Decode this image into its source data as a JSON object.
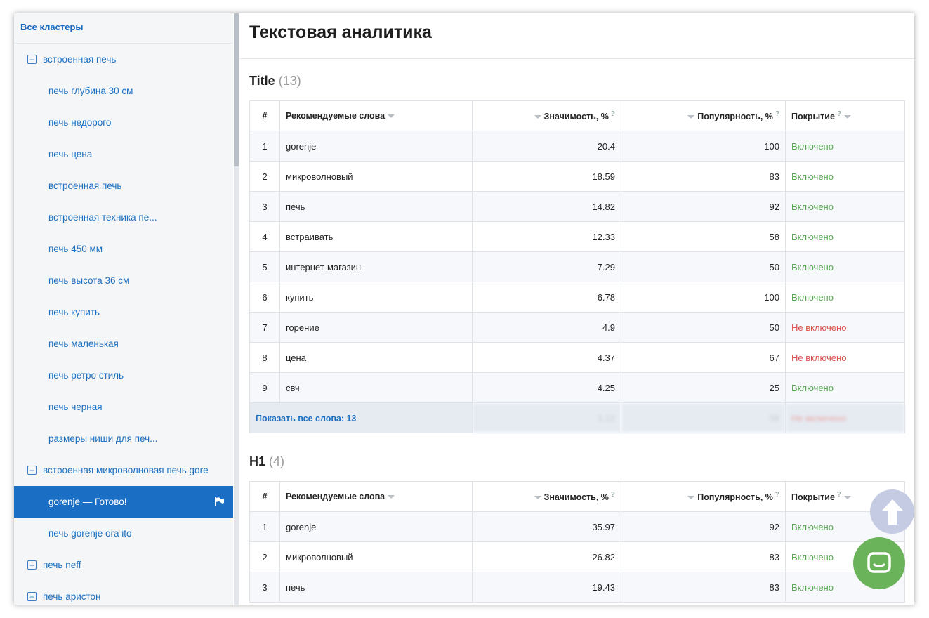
{
  "sidebar": {
    "all_clusters": "Все кластеры",
    "items": [
      {
        "label": "встроенная печь",
        "type": "group",
        "toggle": "−"
      },
      {
        "label": "печь глубина 30 см",
        "type": "item"
      },
      {
        "label": "печь недорого",
        "type": "item"
      },
      {
        "label": "печь цена",
        "type": "item"
      },
      {
        "label": "встроенная печь",
        "type": "item"
      },
      {
        "label": "встроенная техника пе...",
        "type": "item"
      },
      {
        "label": "печь 450 мм",
        "type": "item"
      },
      {
        "label": "печь высота 36 см",
        "type": "item"
      },
      {
        "label": "печь купить",
        "type": "item"
      },
      {
        "label": "печь маленькая",
        "type": "item"
      },
      {
        "label": "печь ретро стиль",
        "type": "item"
      },
      {
        "label": "печь черная",
        "type": "item"
      },
      {
        "label": "размеры ниши для печ...",
        "type": "item"
      },
      {
        "label": "встроенная микроволновая печь gore",
        "type": "group",
        "toggle": "−"
      },
      {
        "label": "gorenje — Готово!",
        "type": "item",
        "active": true
      },
      {
        "label": "печь gorenje ora ito",
        "type": "item"
      },
      {
        "label": "печь neff",
        "type": "group",
        "toggle": "+"
      },
      {
        "label": "печь аристон",
        "type": "group",
        "toggle": "+"
      }
    ]
  },
  "page_title": "Текстовая аналитика",
  "columns": {
    "num": "#",
    "words": "Рекомендуемые слова",
    "significance": "Значимость, %",
    "popularity": "Популярность, %",
    "coverage": "Покрытие",
    "help": "?"
  },
  "title_section": {
    "name": "Title",
    "count": "(13)",
    "rows": [
      {
        "n": "1",
        "word": "gorenje",
        "sig": "20.4",
        "pop": "100",
        "cov": "Включено",
        "status": "on"
      },
      {
        "n": "2",
        "word": "микроволновый",
        "sig": "18.59",
        "pop": "83",
        "cov": "Включено",
        "status": "on"
      },
      {
        "n": "3",
        "word": "печь",
        "sig": "14.82",
        "pop": "92",
        "cov": "Включено",
        "status": "on"
      },
      {
        "n": "4",
        "word": "встраивать",
        "sig": "12.33",
        "pop": "58",
        "cov": "Включено",
        "status": "on"
      },
      {
        "n": "5",
        "word": "интернет-магазин",
        "sig": "7.29",
        "pop": "50",
        "cov": "Включено",
        "status": "on"
      },
      {
        "n": "6",
        "word": "купить",
        "sig": "6.78",
        "pop": "100",
        "cov": "Включено",
        "status": "on"
      },
      {
        "n": "7",
        "word": "горение",
        "sig": "4.9",
        "pop": "50",
        "cov": "Не включено",
        "status": "off"
      },
      {
        "n": "8",
        "word": "цена",
        "sig": "4.37",
        "pop": "67",
        "cov": "Не включено",
        "status": "off"
      },
      {
        "n": "9",
        "word": "свч",
        "sig": "4.25",
        "pop": "25",
        "cov": "Включено",
        "status": "on"
      }
    ],
    "show_all": "Показать все слова: 13",
    "blur_row": {
      "sig": "3.12",
      "pop": "58",
      "cov": "Не включено"
    }
  },
  "h1_section": {
    "name": "H1",
    "count": "(4)",
    "rows": [
      {
        "n": "1",
        "word": "gorenje",
        "sig": "35.97",
        "pop": "92",
        "cov": "Включено",
        "status": "on"
      },
      {
        "n": "2",
        "word": "микроволновый",
        "sig": "26.82",
        "pop": "83",
        "cov": "Включено",
        "status": "on"
      },
      {
        "n": "3",
        "word": "печь",
        "sig": "19.43",
        "pop": "83",
        "cov": "Включено",
        "status": "on"
      }
    ]
  },
  "colors": {
    "accent": "#1a6fc4",
    "included": "#55a64f",
    "not_included": "#d9534f",
    "chat": "#6bb35a"
  },
  "icons": {
    "scroll_up": "arrow-up-icon",
    "chat": "chat-icon",
    "flag": "flag-icon"
  }
}
